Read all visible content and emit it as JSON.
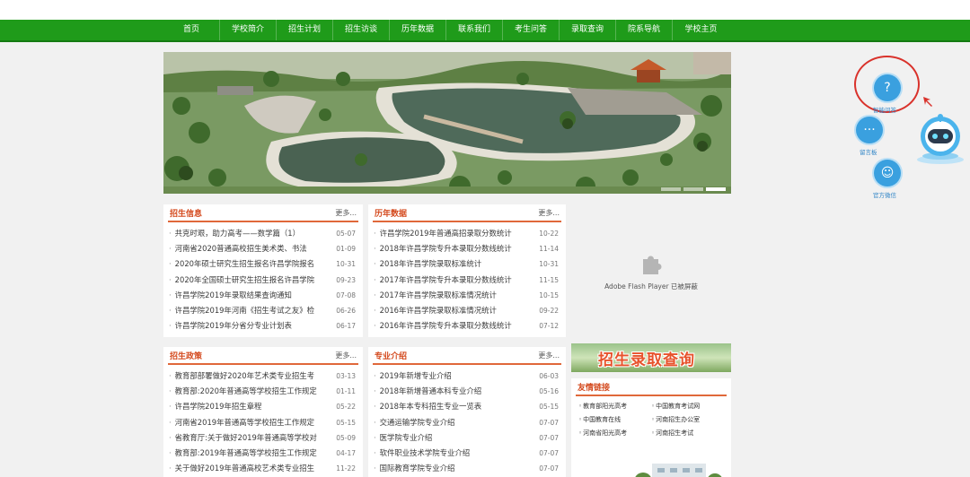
{
  "nav": {
    "items": [
      "首页",
      "学校简介",
      "招生计划",
      "招生访谈",
      "历年数据",
      "联系我们",
      "考生问答",
      "录取查询",
      "院系导航",
      "学校主页"
    ]
  },
  "panels": {
    "admission_info": {
      "title": "招生信息",
      "more": "更多...",
      "items": [
        {
          "title": "共克时艰，助力高考——数学篇（1）",
          "date": "05-07"
        },
        {
          "title": "河南省2020普通高校招生美术类、书法",
          "date": "01-09"
        },
        {
          "title": "2020年硕士研究生招生报名许昌学院报名",
          "date": "10-31"
        },
        {
          "title": "2020年全国硕士研究生招生报名许昌学院",
          "date": "09-23"
        },
        {
          "title": "许昌学院2019年录取结果查询通知",
          "date": "07-08"
        },
        {
          "title": "许昌学院2019年河南《招生考试之友》检",
          "date": "06-26"
        },
        {
          "title": "许昌学院2019年分省分专业计划表",
          "date": "06-17"
        }
      ]
    },
    "history_data": {
      "title": "历年数据",
      "more": "更多...",
      "items": [
        {
          "title": "许昌学院2019年普通高招录取分数统计",
          "date": "10-22"
        },
        {
          "title": "2018年许昌学院专升本录取分数线统计",
          "date": "11-14"
        },
        {
          "title": "2018年许昌学院录取标准统计",
          "date": "10-31"
        },
        {
          "title": "2017年许昌学院专升本录取分数线统计",
          "date": "11-15"
        },
        {
          "title": "2017年许昌学院录取标准情况统计",
          "date": "10-15"
        },
        {
          "title": "2016年许昌学院录取标准情况统计",
          "date": "09-22"
        },
        {
          "title": "2016年许昌学院专升本录取分数线统计",
          "date": "07-12"
        }
      ]
    },
    "admission_policy": {
      "title": "招生政策",
      "more": "更多...",
      "items": [
        {
          "title": "教育部部署做好2020年艺术类专业招生考",
          "date": "03-13"
        },
        {
          "title": "教育部:2020年普通高等学校招生工作规定",
          "date": "01-11"
        },
        {
          "title": "许昌学院2019年招生章程",
          "date": "05-22"
        },
        {
          "title": "河南省2019年普通高等学校招生工作规定",
          "date": "05-15"
        },
        {
          "title": "省教育厅:关于做好2019年普通高等学校对",
          "date": "05-09"
        },
        {
          "title": "教育部:2019年普通高等学校招生工作规定",
          "date": "04-17"
        },
        {
          "title": "关于做好2019年普通高校艺术类专业招生",
          "date": "11-22"
        }
      ]
    },
    "majors": {
      "title": "专业介绍",
      "more": "更多...",
      "items": [
        {
          "title": "2019年新增专业介绍",
          "date": "06-03"
        },
        {
          "title": "2018年新增普通本科专业介绍",
          "date": "05-16"
        },
        {
          "title": "2018年本专科招生专业一览表",
          "date": "05-15"
        },
        {
          "title": "交通运输学院专业介绍",
          "date": "07-07"
        },
        {
          "title": "医学院专业介绍",
          "date": "07-07"
        },
        {
          "title": "软件职业技术学院专业介绍",
          "date": "07-07"
        },
        {
          "title": "国际教育学院专业介绍",
          "date": "07-07"
        }
      ]
    },
    "friend_links": {
      "title": "友情链接",
      "items": [
        "教育部阳光高考",
        "中国教育考试网",
        "中国教育在线",
        "河南招生办公室",
        "河南省阳光高考",
        "河南招生考试"
      ]
    }
  },
  "flash": {
    "text": "Adobe Flash Player 已被屏蔽"
  },
  "query_banner": {
    "text": "招生录取查询"
  },
  "float": {
    "qa_label": "智能问答",
    "message_label": "留言板",
    "wechat_label": "官方微信"
  },
  "colors": {
    "nav_green": "#1f9b1a",
    "accent_orange": "#e0683a",
    "float_blue": "#3aa0df",
    "highlight_red": "#d9322b"
  }
}
